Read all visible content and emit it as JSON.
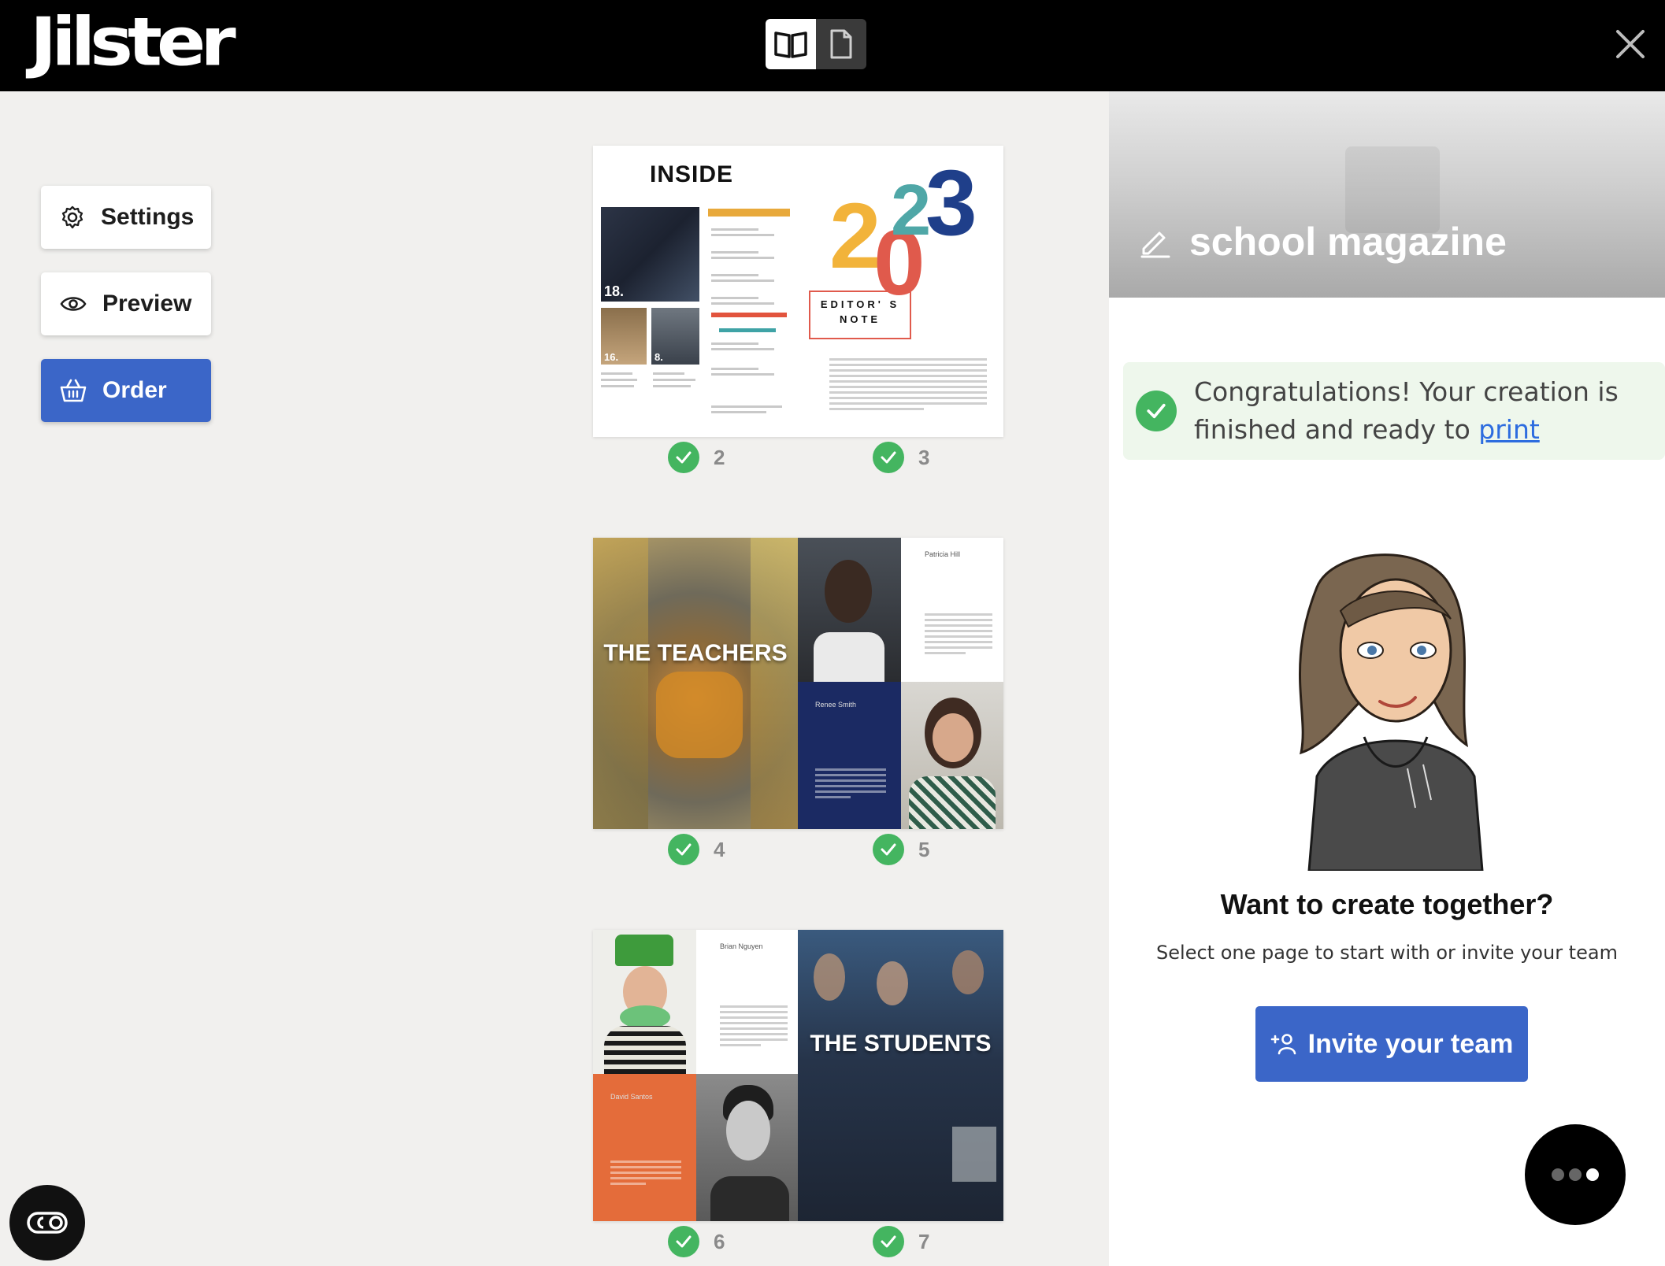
{
  "app": {
    "logo": "Jilster"
  },
  "toolbar": {
    "view_modes": [
      {
        "icon": "open-book-icon",
        "active": true
      },
      {
        "icon": "single-page-icon",
        "active": false
      }
    ],
    "close_icon": "close-icon"
  },
  "sidebar": {
    "settings_label": "Settings",
    "preview_label": "Preview",
    "order_label": "Order"
  },
  "spreads": [
    {
      "pages": [
        "2",
        "3"
      ]
    },
    {
      "pages": [
        "4",
        "5"
      ]
    },
    {
      "pages": [
        "6",
        "7"
      ]
    }
  ],
  "spread_content": {
    "inside_title": "INSIDE",
    "year": [
      "2",
      "0",
      "2",
      "3"
    ],
    "editors_note": "EDITOR' S NOTE",
    "photo_numbers": [
      "18.",
      "16.",
      "8."
    ],
    "teachers_title": "THE TEACHERS",
    "students_title": "THE STUDENTS",
    "names": [
      "Patricia Hill",
      "Renee Smith",
      "Brian Nguyen",
      "David Santos"
    ]
  },
  "panel": {
    "title": "school magazine",
    "congrats_text": "Congratulations! Your creation is finished and ready to",
    "congrats_link": "print",
    "collab_title": "Want to create together?",
    "collab_subtitle": "Select one page to start with or invite your team",
    "invite_label": "Invite your team"
  },
  "colors": {
    "topbar": "#000000",
    "primary": "#3b66c8",
    "success": "#44b560",
    "canvas": "#f1f0ee",
    "link": "#2d6cdf"
  }
}
